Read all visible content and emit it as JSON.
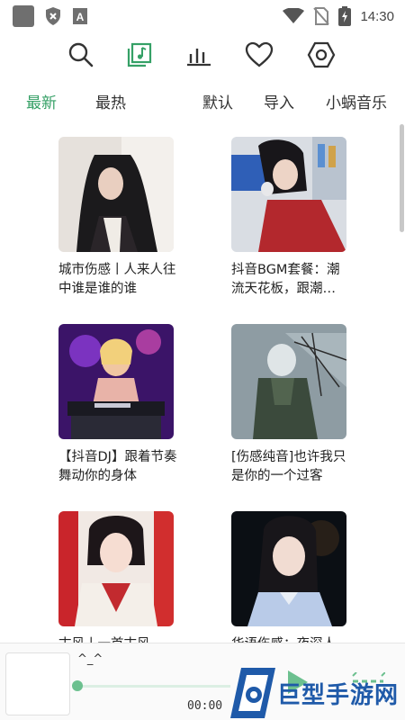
{
  "status_bar": {
    "time": "14:30",
    "icons": [
      "notification-square-icon",
      "shield-x-icon",
      "a-app-icon",
      "wifi-icon",
      "no-sim-icon",
      "battery-charging-icon"
    ]
  },
  "top_nav": {
    "icons": [
      "search-icon",
      "music-library-icon",
      "chart-bars-icon",
      "heart-icon",
      "settings-hexagon-icon"
    ],
    "active": "music-library-icon",
    "accent": "#35a066"
  },
  "tabs": {
    "items": [
      "最新",
      "最热",
      "默认",
      "导入",
      "小蜗音乐"
    ],
    "active_index": 0
  },
  "playlists": [
    {
      "title": "城市伤感丨人来人往中谁是谁的谁"
    },
    {
      "title": "抖音BGM套餐：潮流天花板，跟潮…"
    },
    {
      "title": "【抖音DJ】跟着节奏舞动你的身体"
    },
    {
      "title": "[伤感纯音]也许我只是你的一个过客"
    },
    {
      "title": "古风丨一首古风"
    },
    {
      "title": "华语伤感：夜深人"
    }
  ],
  "player": {
    "title": "^_^",
    "time": "00:00",
    "progress": 0.0
  },
  "watermark": {
    "text": "巨型手游网"
  }
}
